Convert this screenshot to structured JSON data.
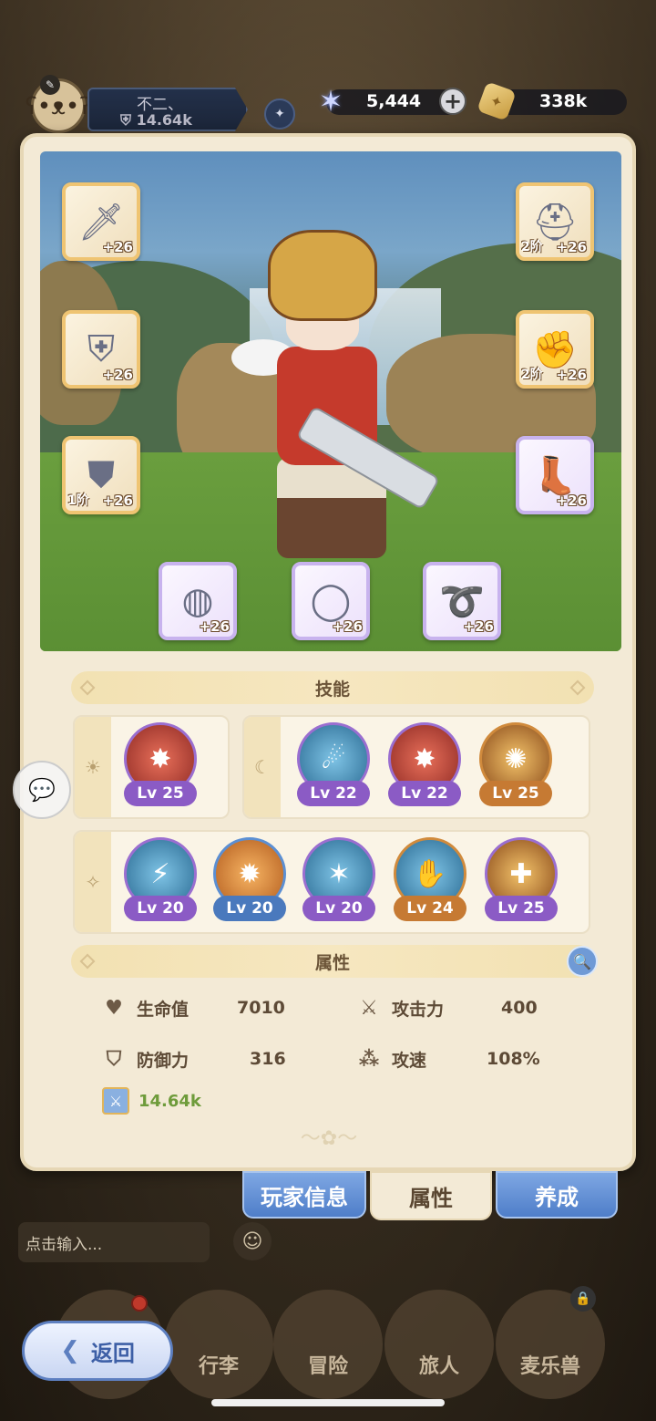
{
  "player": {
    "name": "不二、",
    "power": "14.64k"
  },
  "currency": {
    "gems": "5,444",
    "coins": "338k"
  },
  "equipment": [
    {
      "slot": "weapon",
      "icon": "sword-icon",
      "level": "+26",
      "tier": ""
    },
    {
      "slot": "helmet",
      "icon": "helmet-icon",
      "level": "+26",
      "tier": "2阶"
    },
    {
      "slot": "armor",
      "icon": "armor-icon",
      "level": "+26",
      "tier": ""
    },
    {
      "slot": "gloves",
      "icon": "gauntlet-icon",
      "level": "+26",
      "tier": "2阶"
    },
    {
      "slot": "pants",
      "icon": "leg-armor-icon",
      "level": "+26",
      "tier": "1阶"
    },
    {
      "slot": "boots",
      "icon": "boots-icon",
      "level": "+26",
      "tier": ""
    },
    {
      "slot": "ring",
      "icon": "ring-icon",
      "level": "+26",
      "tier": ""
    },
    {
      "slot": "necklace",
      "icon": "necklace-icon",
      "level": "+26",
      "tier": ""
    },
    {
      "slot": "amulet",
      "icon": "amulet-icon",
      "level": "+26",
      "tier": ""
    }
  ],
  "skills_section": {
    "title": "技能"
  },
  "skill_groups": {
    "day": {
      "icon": "sun-icon",
      "skills": [
        {
          "lv": "Lv 25"
        }
      ]
    },
    "night": {
      "icon": "moon-icon",
      "skills": [
        {
          "lv": "Lv 22"
        },
        {
          "lv": "Lv 22"
        },
        {
          "lv": "Lv 25"
        }
      ]
    },
    "passive": {
      "icon": "sparkle-icon",
      "skills": [
        {
          "lv": "Lv 20"
        },
        {
          "lv": "Lv 20"
        },
        {
          "lv": "Lv 20"
        },
        {
          "lv": "Lv 24"
        },
        {
          "lv": "Lv 25"
        }
      ]
    }
  },
  "attributes_section": {
    "title": "属性"
  },
  "attributes": {
    "hp": {
      "label": "生命值",
      "value": "7010"
    },
    "attack": {
      "label": "攻击力",
      "value": "400"
    },
    "defense": {
      "label": "防御力",
      "value": "316"
    },
    "attack_speed": {
      "label": "攻速",
      "value": "108%"
    },
    "power": "14.64k"
  },
  "tabs": {
    "player_info": "玩家信息",
    "attributes": "属性",
    "develop": "养成"
  },
  "chat": {
    "placeholder": "点击输入..."
  },
  "nav": {
    "bag": "行李",
    "adventure": "冒险",
    "traveler": "旅人",
    "pet": "麦乐兽",
    "back": "返回"
  }
}
